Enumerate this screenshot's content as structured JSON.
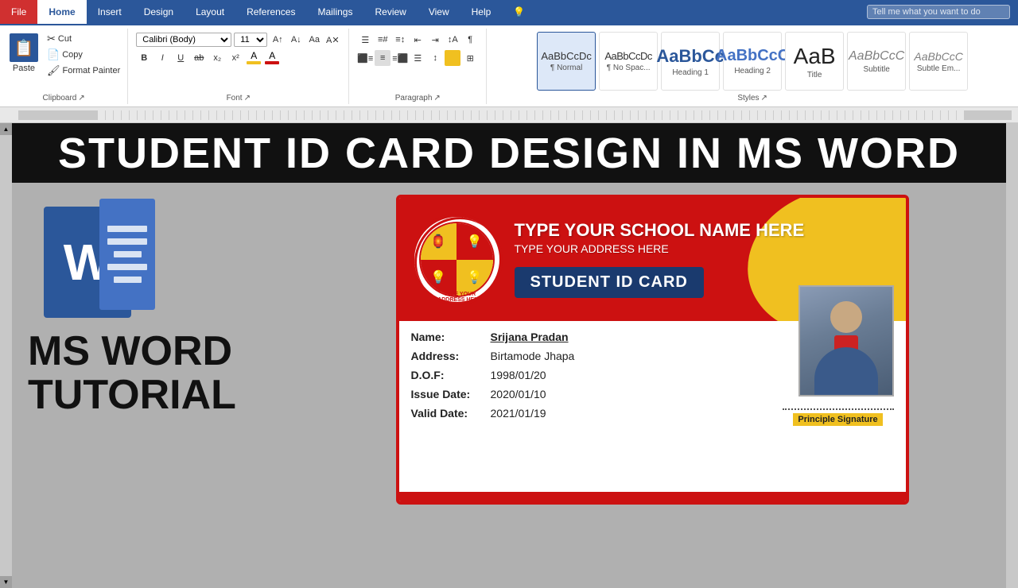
{
  "ribbon": {
    "tabs": [
      "File",
      "Home",
      "Insert",
      "Design",
      "Layout",
      "References",
      "Mailings",
      "Review",
      "View",
      "Help"
    ],
    "active_tab": "Home",
    "tell_me": "Tell me what you want to do",
    "groups": {
      "clipboard": {
        "label": "Clipboard",
        "paste": "Paste",
        "copy": "Copy",
        "cut": "Cut",
        "format_painter": "Format Painter"
      },
      "font": {
        "label": "Font",
        "name": "Calibri (Body)",
        "size": "11",
        "grow_icon": "A+",
        "shrink_icon": "A-",
        "case_icon": "Aa",
        "clear_icon": "A✕",
        "bold": "B",
        "italic": "I",
        "underline": "U",
        "strikethrough": "ab",
        "subscript": "x₂",
        "superscript": "x²",
        "text_color": "A",
        "highlight": "A"
      },
      "paragraph": {
        "label": "Paragraph"
      },
      "styles": {
        "label": "Styles",
        "items": [
          {
            "name": "¶ Normal",
            "preview": "AaBbCcDc",
            "active": true
          },
          {
            "name": "¶ No Spac...",
            "preview": "AaBbCcDc",
            "active": false
          },
          {
            "name": "Heading 1",
            "preview": "AaBbCc",
            "active": false
          },
          {
            "name": "Heading 2",
            "preview": "AaBbCcC",
            "active": false
          },
          {
            "name": "Title",
            "preview": "AaB",
            "active": false
          },
          {
            "name": "Subtitle",
            "preview": "AaBbCcC",
            "active": false
          },
          {
            "name": "Subtle Em...",
            "preview": "AaBbCcC",
            "active": false
          }
        ]
      }
    }
  },
  "banner": {
    "text": "STUDENT ID CARD DESIGN IN MS WORD"
  },
  "tutorial": {
    "app_name": "MS WORD",
    "subtitle": "TUTORIAL",
    "logo_letter": "W"
  },
  "id_card": {
    "school_name": "TYPE YOUR SCHOOL NAME HERE",
    "address": "TYPE YOUR ADDRESS HERE",
    "badge": "STUDENT ID CARD",
    "emblem_ring_text": "TYPE YOUR SCHOOL NAME HERE · TYPE YOUR ADDRESS HERE ·",
    "fields": [
      {
        "label": "Name:",
        "value": "Srijana Pradan",
        "underline": true
      },
      {
        "label": "Address:",
        "value": " Birtamode Jhapa",
        "underline": false
      },
      {
        "label": "D.O.F:",
        "value": "1998/01/20",
        "underline": false
      },
      {
        "label": "Issue Date:",
        "value": "2020/01/10",
        "underline": false
      },
      {
        "label": "Valid Date:",
        "value": "2021/01/19",
        "underline": false
      }
    ],
    "signature_label": "Principle Signature"
  }
}
